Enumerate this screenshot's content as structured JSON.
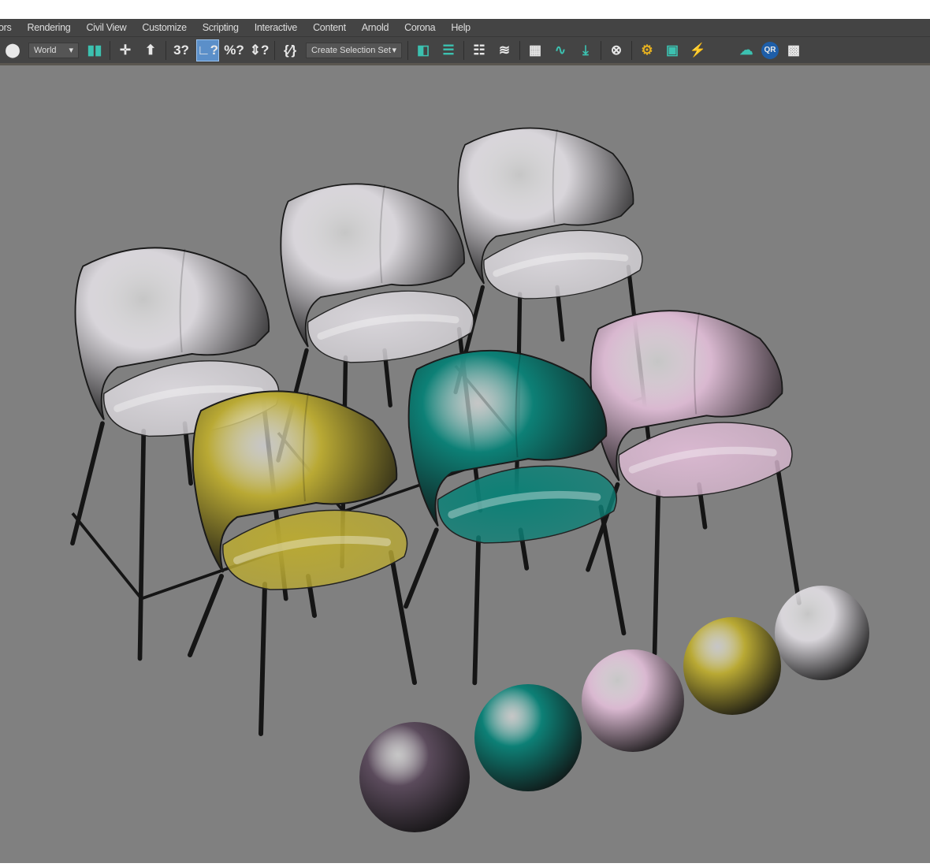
{
  "menubar": {
    "items": [
      "ors",
      "Rendering",
      "Civil View",
      "Customize",
      "Scripting",
      "Interactive",
      "Content",
      "Arnold",
      "Corona",
      "Help"
    ]
  },
  "toolbar": {
    "reference_coord_system": "World",
    "named_selection_set": "Create Selection Set",
    "icons_left": [
      {
        "name": "select-and-link-icon",
        "glyph": "⬤"
      },
      {
        "name": "use-pivot-center-icon",
        "glyph": "▮▮"
      },
      {
        "name": "select-manipulate-icon",
        "glyph": "✛"
      },
      {
        "name": "keyboard-shortcut-override-icon",
        "glyph": "⬆"
      },
      {
        "name": "snaps-toggle-icon",
        "glyph": "3?"
      },
      {
        "name": "angle-snap-icon",
        "glyph": "∟?"
      },
      {
        "name": "percent-snap-icon",
        "glyph": "%?"
      },
      {
        "name": "spinner-snap-icon",
        "glyph": "⇕?"
      },
      {
        "name": "edit-named-selection-icon",
        "glyph": "{⁄}"
      }
    ],
    "icons_right": [
      {
        "name": "mirror-icon",
        "glyph": "◧"
      },
      {
        "name": "align-icon",
        "glyph": "☰"
      },
      {
        "name": "scene-explorer-icon",
        "glyph": "☷"
      },
      {
        "name": "layer-explorer-icon",
        "glyph": "≋"
      },
      {
        "name": "toggle-ribbon-icon",
        "glyph": "▦"
      },
      {
        "name": "curve-editor-icon",
        "glyph": "∿"
      },
      {
        "name": "dope-sheet-icon",
        "glyph": "⤓"
      },
      {
        "name": "schematic-view-icon",
        "glyph": "⊗"
      },
      {
        "name": "render-setup-icon",
        "glyph": "⚙"
      },
      {
        "name": "rendered-frame-window-icon",
        "glyph": "▣"
      },
      {
        "name": "render-production-icon",
        "glyph": "⚡"
      },
      {
        "name": "render-cloud-icon",
        "glyph": "☁"
      },
      {
        "name": "qr-icon",
        "glyph": "QR"
      },
      {
        "name": "render-grid-icon",
        "glyph": "▩"
      }
    ]
  },
  "colors": {
    "viewport": "#808080",
    "yellow": "#b9a934",
    "teal": "#0d8076",
    "pink": "#d9b8d0",
    "white": "#d8d5da",
    "purple": "#5b4b5c",
    "legs": "#151515"
  }
}
